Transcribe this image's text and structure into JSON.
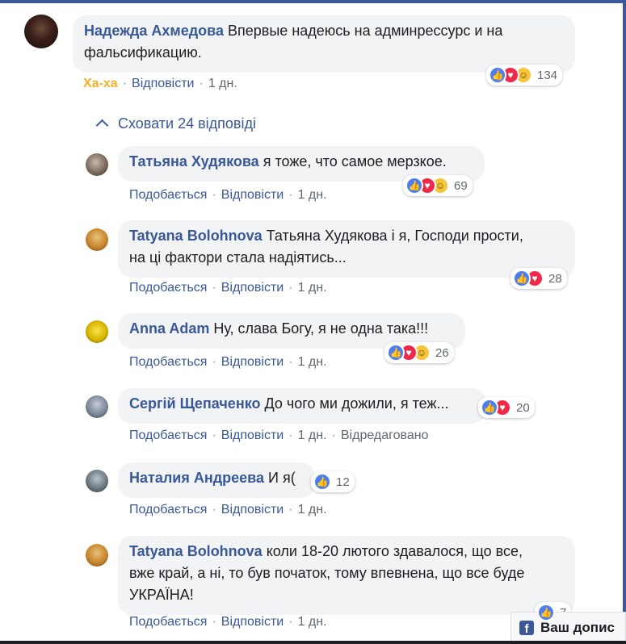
{
  "comments": [
    {
      "author": "Надежда Ахмедова",
      "line1": "Впервые надеюсь на админрессурс и на",
      "line2": "фальсификацию.",
      "reaction_label": "Ха-ха",
      "reply": "Відповісти",
      "time": "1 дн.",
      "reaction_count": "134",
      "reactions": [
        "like",
        "love",
        "haha"
      ]
    },
    {
      "author": "Татьяна Худякова",
      "text": "я тоже, что самое мерзкое.",
      "like": "Подобається",
      "reply": "Відповісти",
      "time": "1 дн.",
      "reaction_count": "69",
      "reactions": [
        "like",
        "love",
        "haha"
      ]
    },
    {
      "author": "Tatyana Bolohnova",
      "line1": "Татьяна Худякова і я, Господи прости,",
      "line2": "на ці фактори стала надіятись...",
      "like": "Подобається",
      "reply": "Відповісти",
      "time": "1 дн.",
      "reaction_count": "28",
      "reactions": [
        "like",
        "love"
      ]
    },
    {
      "author": "Anna Adam",
      "text": "Ну, слава Богу, я не одна така!!!",
      "like": "Подобається",
      "reply": "Відповісти",
      "time": "1 дн.",
      "reaction_count": "26",
      "reactions": [
        "like",
        "love",
        "haha"
      ]
    },
    {
      "author": "Сергій Щепаченко",
      "text": "До чого ми дожили, я теж...",
      "like": "Подобається",
      "reply": "Відповісти",
      "time": "1 дн.",
      "edited": "Відредаговано",
      "reaction_count": "20",
      "reactions": [
        "like",
        "love"
      ]
    },
    {
      "author": "Наталия Андреева",
      "text": "И я(",
      "like": "Подобається",
      "reply": "Відповісти",
      "time": "1 дн.",
      "reaction_count": "12",
      "reactions": [
        "like"
      ]
    },
    {
      "author": "Tatyana Bolohnova",
      "line1": "коли 18-20 лютого здавалося, що все,",
      "line2": "вже край, а ні, то був початок, тому впевнена, що все буде",
      "line3": "УКРАЇНА!",
      "like": "Подобається",
      "reply": "Відповісти",
      "time": "1 дн.",
      "reaction_count": "7",
      "reactions": [
        "like"
      ]
    }
  ],
  "hide_replies": "Сховати 24 відповіді",
  "fb_badge": "Ваш допис",
  "fb_logo": "f",
  "colors": {
    "link": "#385898",
    "haha": "#f7b125",
    "bubble": "#f2f3f5",
    "like": "#4c7ef3",
    "love": "#f0284a"
  }
}
